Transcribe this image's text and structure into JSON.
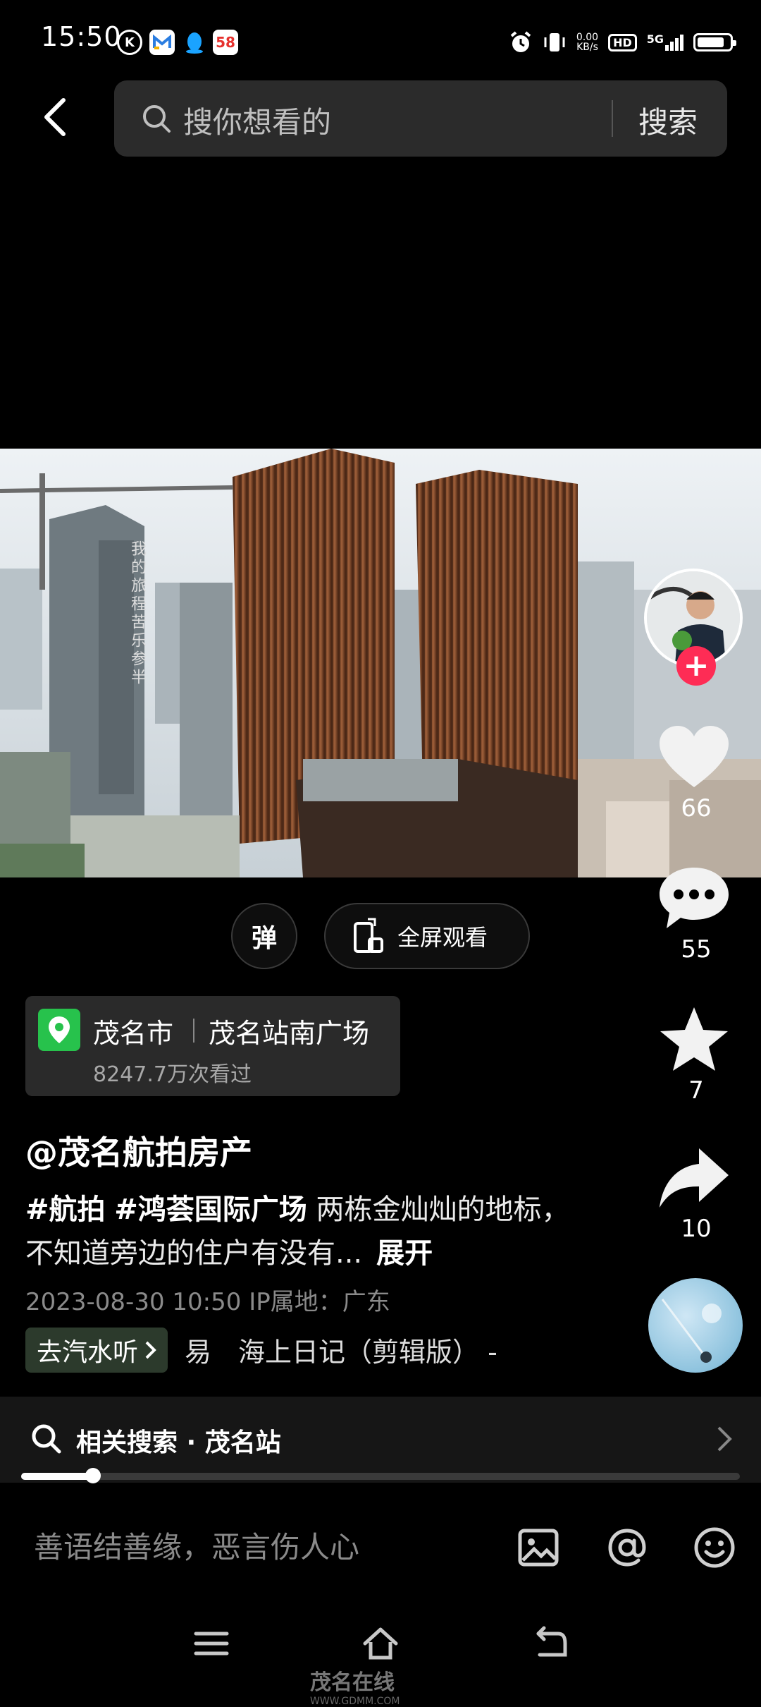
{
  "status_bar": {
    "time": "15:50",
    "notification_icons": [
      "k-circle-icon",
      "mail-app-icon",
      "qq-penguin-icon",
      "58-app-icon"
    ],
    "icon_58_label": "58",
    "net_speed_value": "0.00",
    "net_speed_unit": "KB/s",
    "hd_label": "HD",
    "network_label": "5G",
    "battery_level": 0.85
  },
  "search": {
    "placeholder": "搜你想看的",
    "button_label": "搜索"
  },
  "video": {
    "building_sign": "我的旅程苦乐参半"
  },
  "actions": {
    "like_count": "66",
    "comment_count": "55",
    "favorite_count": "7",
    "share_count": "10"
  },
  "controls": {
    "danmu_label": "弹",
    "fullscreen_label": "全屏观看"
  },
  "location": {
    "city": "茂名市",
    "place": "茂名站南广场",
    "views": "8247.7万次看过"
  },
  "post": {
    "author": "@茂名航拍房产",
    "hashtag1": "#航拍",
    "hashtag2": "#鸿荟国际广场",
    "text": "两栋金灿灿的地标，不知道旁边的住户有没有...",
    "expand_label": "展开",
    "date": "2023-08-30 10:50  IP属地：广东"
  },
  "music": {
    "tag_label": "去汽水听",
    "track": "易　海上日记（剪辑版） -"
  },
  "related": {
    "label": "相关搜索 · 茂名站"
  },
  "playback": {
    "progress": 0.1
  },
  "comment": {
    "placeholder": "善语结善缘，恶言伤人心"
  },
  "watermark": {
    "text": "茂名在线",
    "url": "WWW.GDMM.COM"
  },
  "colors": {
    "accent": "#fe2c55",
    "location_pin": "#27c24c"
  }
}
